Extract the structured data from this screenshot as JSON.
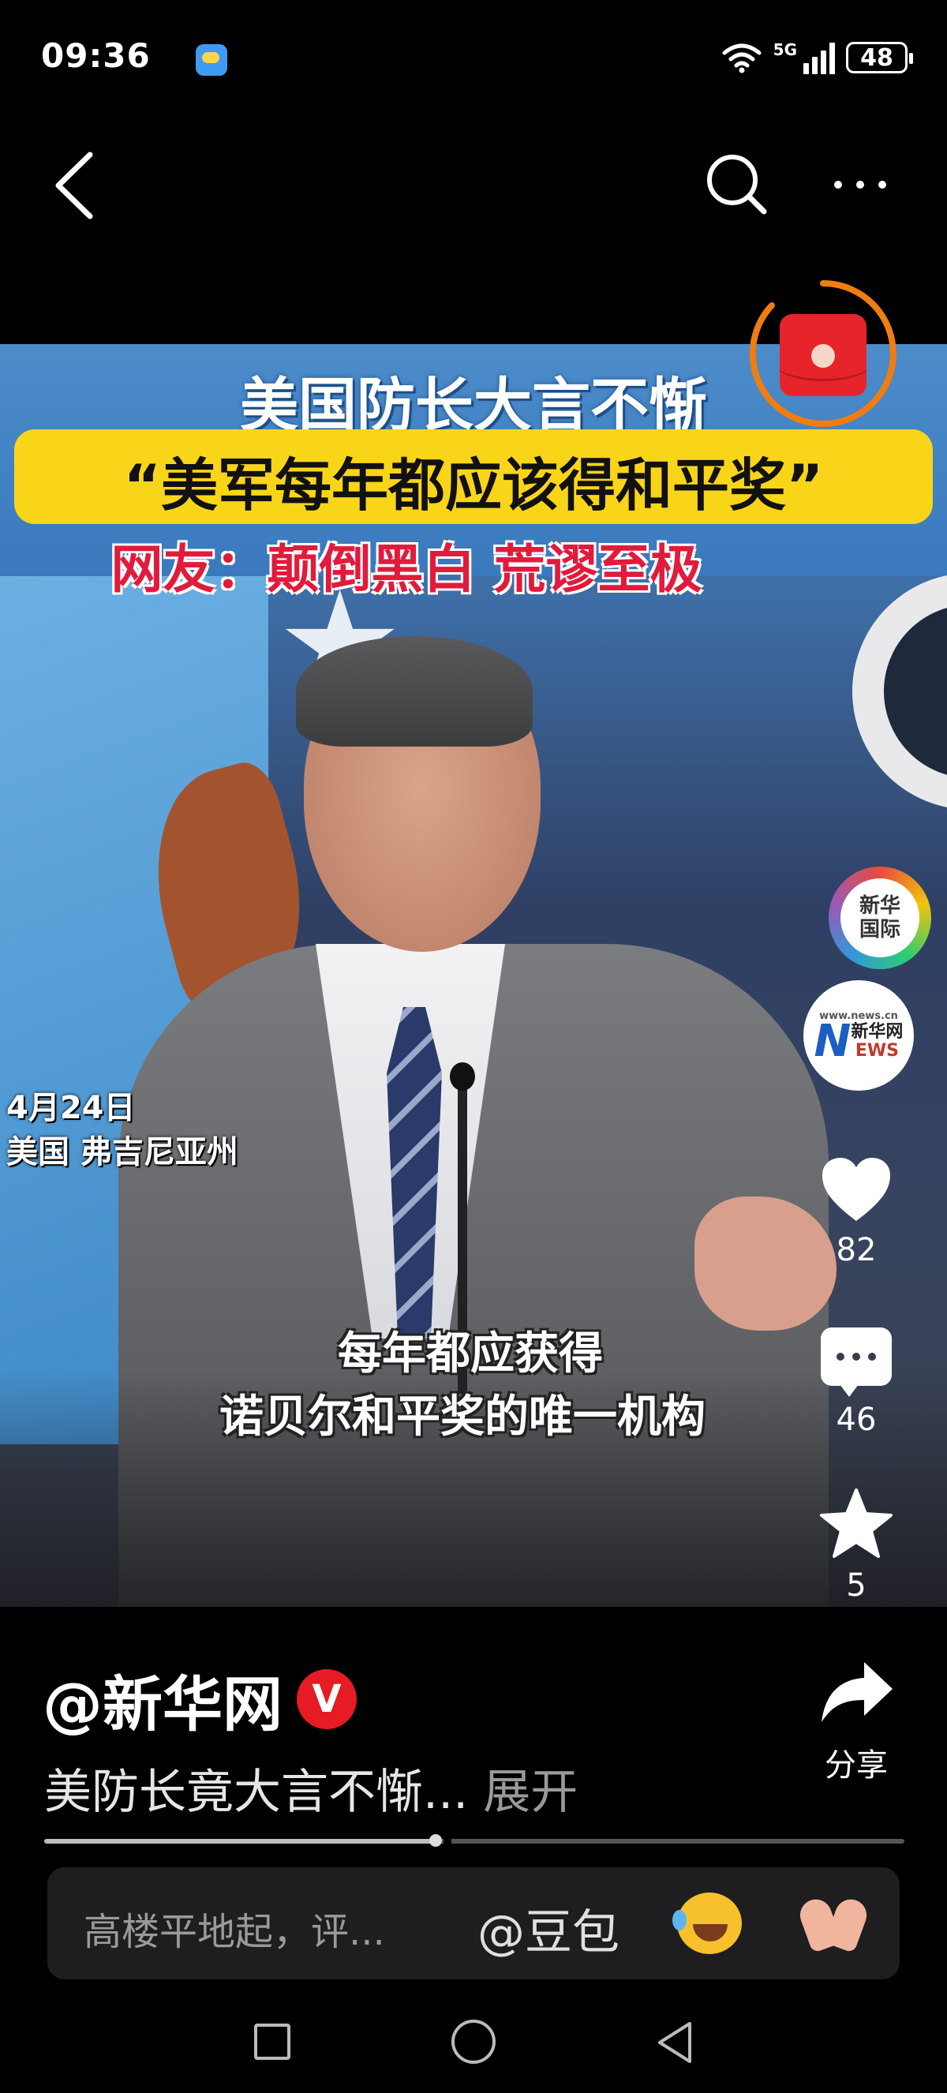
{
  "status_bar": {
    "time": "09:36",
    "network_label": "5G",
    "battery_level": "48",
    "icons": [
      "hand-icon",
      "weather-icon",
      "wifi-icon",
      "signal-icon",
      "battery-icon"
    ]
  },
  "top_nav": {
    "icons": [
      "back-icon",
      "search-icon",
      "more-icon"
    ]
  },
  "video": {
    "headline_1": "美国防长大言不惭",
    "headline_2": "“美军每年都应该得和平奖”",
    "headline_3": "网友：颠倒黑白 荒谬至极",
    "location_date": "4月24日",
    "location_place": "美国 弗吉尼亚州",
    "subtitle_line_1": "每年都应获得",
    "subtitle_line_2": "诺贝尔和平奖的唯一机构",
    "red_packet_icon": "red-packet-icon"
  },
  "right_rail": {
    "logo_1_text": "新华\n国际",
    "logo_2_top": "www.news.cn",
    "logo_2_mark": "N",
    "logo_2_name": "新华网",
    "logo_2_ews": "EWS",
    "likes": "82",
    "comments": "46",
    "favorites": "5"
  },
  "post": {
    "author": "@新华网",
    "verified_badge": "V",
    "description": "美防长竟大言不惭...",
    "expand_label": "展开",
    "share_label": "分享",
    "progress": 0.455
  },
  "comment_bar": {
    "placeholder": "高楼平地起，评...",
    "at_label": "@豆包",
    "emojis": [
      "laughing-crying-emoji",
      "praying-hands-emoji"
    ]
  },
  "colors": {
    "headline_box": "#f9d51a",
    "headline_3": "#e11b3c",
    "verified": "#e51c23",
    "red_packet_ring": "#f07d10"
  }
}
